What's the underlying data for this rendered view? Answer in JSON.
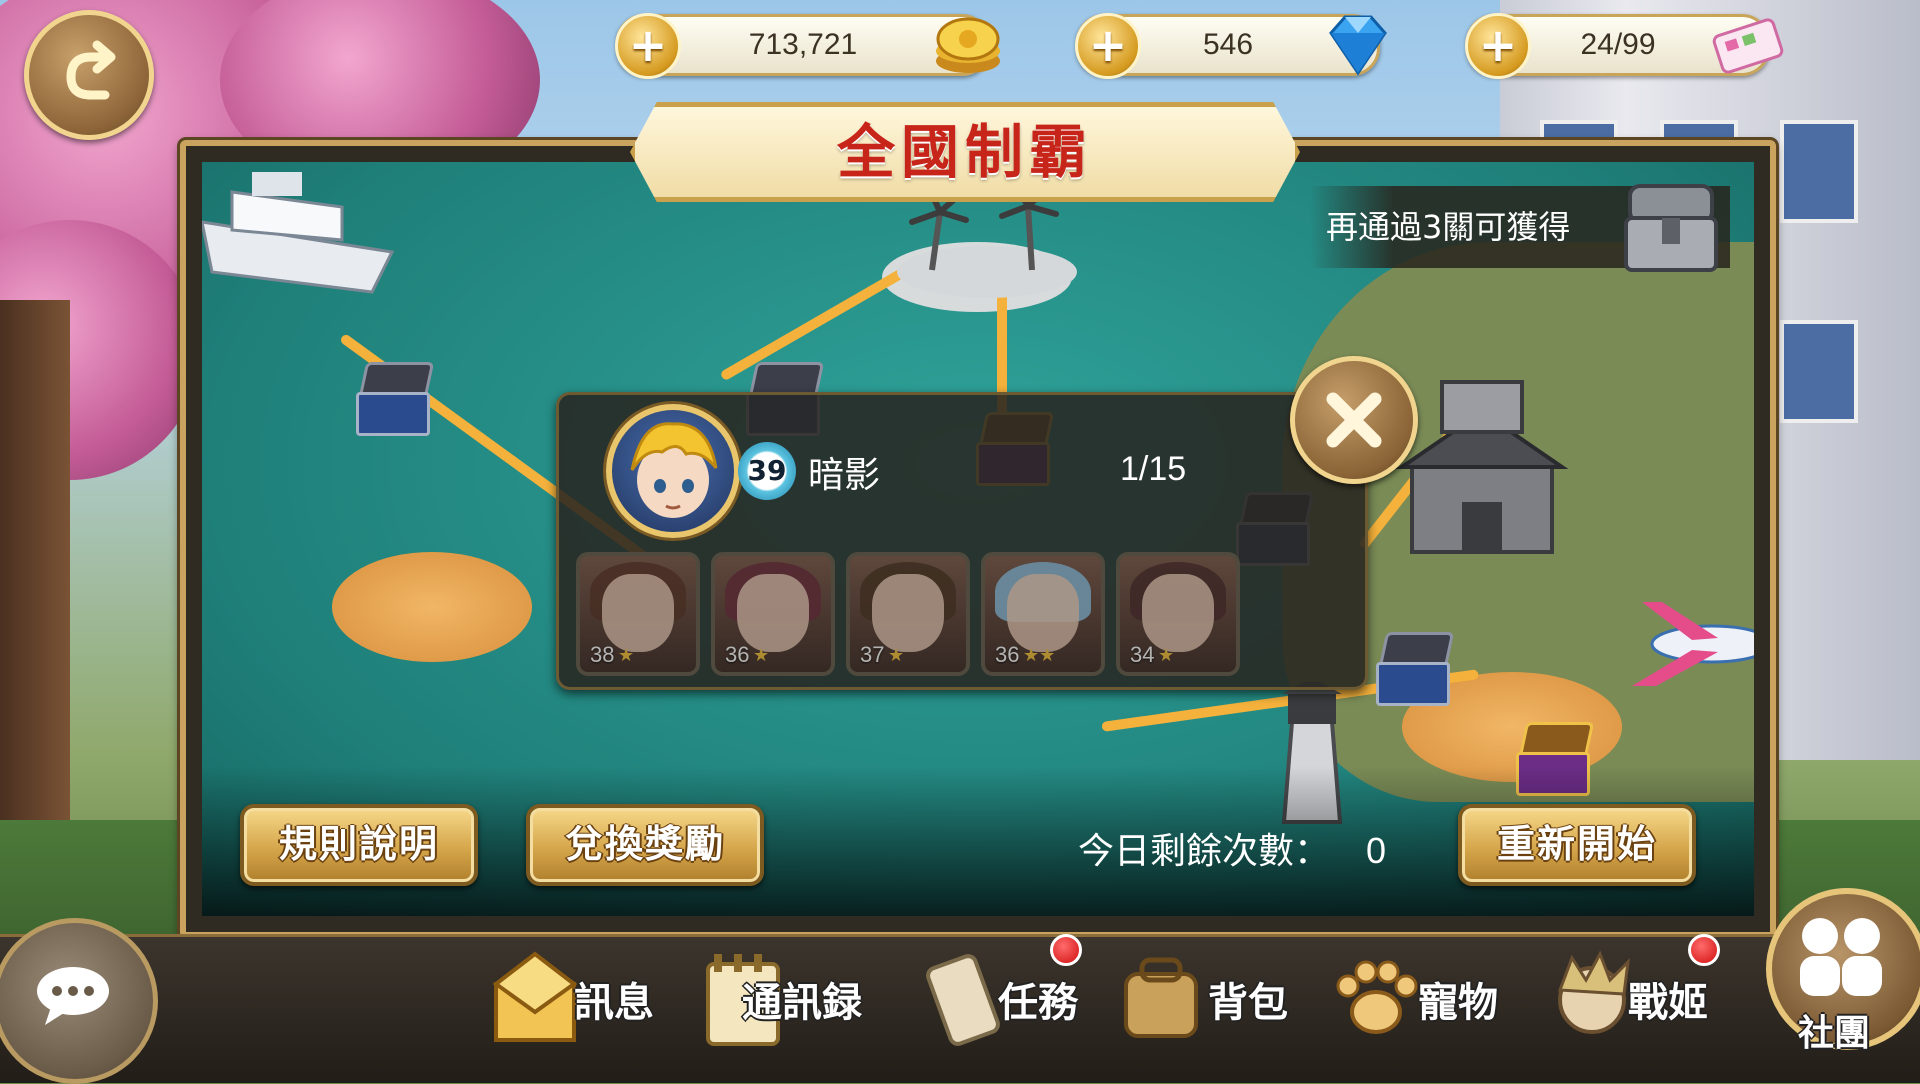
{
  "resources": {
    "gold": {
      "value": "713,721",
      "icon": "gold-coin-icon"
    },
    "gems": {
      "value": "546",
      "icon": "blue-diamond-icon"
    },
    "stamina": {
      "value": "24/99",
      "icon": "ticket-box-icon"
    }
  },
  "title": "全國制霸",
  "reward_hint": "再通過3關可獲得",
  "opponent": {
    "level": "39",
    "name": "暗影",
    "progress": "1/15",
    "team": [
      {
        "level": "38",
        "stars": 1
      },
      {
        "level": "36",
        "stars": 1
      },
      {
        "level": "37",
        "stars": 1
      },
      {
        "level": "36",
        "stars": 2
      },
      {
        "level": "34",
        "stars": 1
      }
    ]
  },
  "actions": {
    "rules_label": "規則說明",
    "exchange_label": "兌換獎勵",
    "remaining_label": "今日剩餘次數：",
    "remaining_value": "0",
    "restart_label": "重新開始"
  },
  "nav": {
    "messages": "訊息",
    "contacts": "通訊録",
    "tasks": "任務",
    "backpack": "背包",
    "pets": "寵物",
    "heroines": "戰姬",
    "club": "社團"
  },
  "colors": {
    "title_red": "#c8251a",
    "frame_gold": "#caa45e",
    "sea": "#1f7f79",
    "notify_red": "#d10f0f"
  }
}
